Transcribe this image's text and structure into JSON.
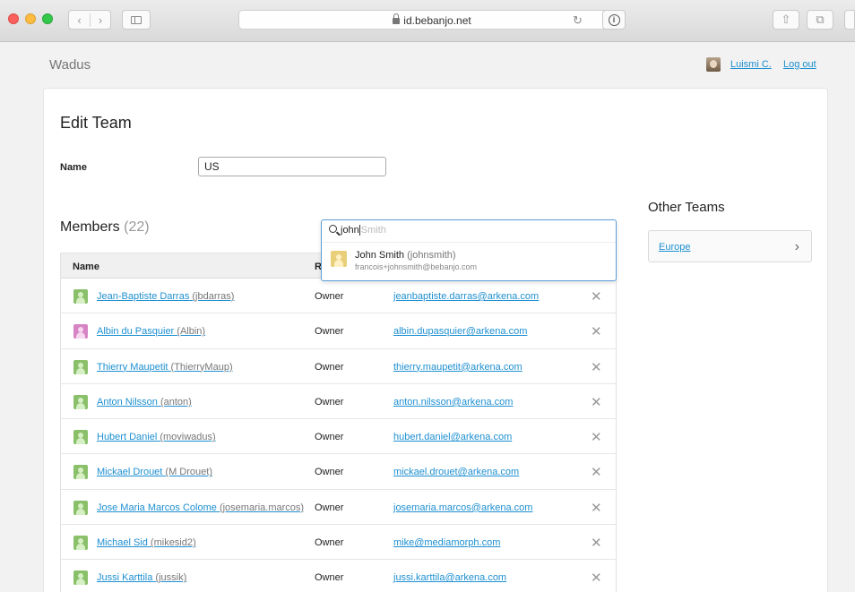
{
  "browser": {
    "url": "id.bebanjo.net",
    "reload_glyph": "↻",
    "info_glyph": "i",
    "back_glyph": "‹",
    "forward_glyph": "›",
    "share_glyph": "⇧",
    "tabs_glyph": "⧉"
  },
  "header": {
    "brand": "Wadus",
    "user_name": "Luismi C.",
    "logout_label": "Log out"
  },
  "form": {
    "title": "Edit Team",
    "name_label": "Name",
    "name_value": "US"
  },
  "members": {
    "title": "Members",
    "count": "(22)",
    "columns": {
      "name": "Name",
      "role": "R"
    },
    "remove_glyph": "✕",
    "rows": [
      {
        "name": "Jean-Baptiste Darras",
        "handle": "(jbdarras)",
        "role": "Owner",
        "email": "jeanbaptiste.darras@arkena.com",
        "avatar_color": "#8ac06a",
        "avatar_fg": "#d6efc4"
      },
      {
        "name": "Albin du Pasquier",
        "handle": "(Albin)",
        "role": "Owner",
        "email": "albin.dupasquier@arkena.com",
        "avatar_color": "#d784c4",
        "avatar_fg": "#f6d7ef"
      },
      {
        "name": "Thierry Maupetit",
        "handle": "(ThierryMaup)",
        "role": "Owner",
        "email": "thierry.maupetit@arkena.com",
        "avatar_color": "#8ac06a",
        "avatar_fg": "#d6efc4"
      },
      {
        "name": "Anton Nilsson",
        "handle": "(anton)",
        "role": "Owner",
        "email": "anton.nilsson@arkena.com",
        "avatar_color": "#8ac06a",
        "avatar_fg": "#d6efc4"
      },
      {
        "name": "Hubert Daniel",
        "handle": "(moviwadus)",
        "role": "Owner",
        "email": "hubert.daniel@arkena.com",
        "avatar_color": "#8ac06a",
        "avatar_fg": "#d6efc4"
      },
      {
        "name": "Mickael Drouet",
        "handle": "(M Drouet)",
        "role": "Owner",
        "email": "mickael.drouet@arkena.com",
        "avatar_color": "#8ac06a",
        "avatar_fg": "#d6efc4"
      },
      {
        "name": "Jose Maria Marcos Colome",
        "handle": "(josemaria.marcos)",
        "role": "Owner",
        "email": "josemaria.marcos@arkena.com",
        "avatar_color": "#8ac06a",
        "avatar_fg": "#d6efc4"
      },
      {
        "name": "Michael Sid",
        "handle": "(mikesid2)",
        "role": "Owner",
        "email": "mike@mediamorph.com",
        "avatar_color": "#8ac06a",
        "avatar_fg": "#d6efc4"
      },
      {
        "name": "Jussi Karttila",
        "handle": "(jussik)",
        "role": "Owner",
        "email": "jussi.karttila@arkena.com",
        "avatar_color": "#8ac06a",
        "avatar_fg": "#d6efc4"
      }
    ]
  },
  "search": {
    "typed": "john",
    "completion_hint": "Smith",
    "suggestion": {
      "name": "John Smith",
      "handle": "(johnsmith)",
      "email": "francois+johnsmith@bebanjo.com"
    }
  },
  "other_teams": {
    "title": "Other Teams",
    "items": [
      {
        "label": "Europe"
      }
    ],
    "chevron_glyph": "›"
  },
  "colors": {
    "link": "#1d8fd1",
    "focus_border": "#5b9dd9"
  }
}
